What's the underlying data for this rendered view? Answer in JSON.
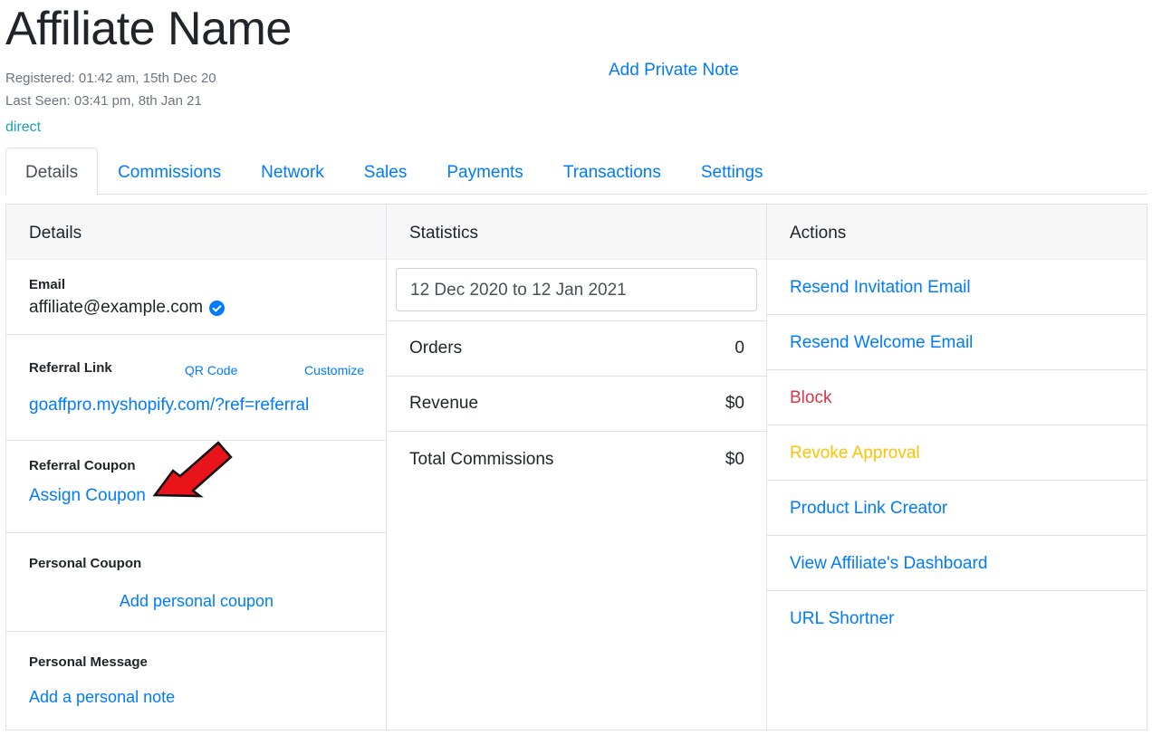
{
  "header": {
    "title": "Affiliate Name",
    "registered": "Registered: 01:42 am, 15th Dec 20",
    "last_seen": "Last Seen: 03:41 pm, 8th Jan 21",
    "source": "direct",
    "private_note_link": "Add Private Note"
  },
  "tabs": [
    {
      "label": "Details",
      "active": true
    },
    {
      "label": "Commissions"
    },
    {
      "label": "Network"
    },
    {
      "label": "Sales"
    },
    {
      "label": "Payments"
    },
    {
      "label": "Transactions"
    },
    {
      "label": "Settings"
    }
  ],
  "details": {
    "heading": "Details",
    "email_label": "Email",
    "email_value": "affiliate@example.com",
    "referral_link_label": "Referral Link",
    "qr_code_link": "QR Code",
    "customize_link": "Customize",
    "referral_link_value": "goaffpro.myshopify.com/?ref=referral",
    "referral_coupon_label": "Referral Coupon",
    "assign_coupon_link": "Assign Coupon",
    "personal_coupon_label": "Personal Coupon",
    "add_personal_coupon_link": "Add personal coupon",
    "personal_message_label": "Personal Message",
    "add_personal_note_link": "Add a personal note"
  },
  "statistics": {
    "heading": "Statistics",
    "date_range": "12 Dec 2020 to 12 Jan 2021",
    "rows": [
      {
        "label": "Orders",
        "value": "0"
      },
      {
        "label": "Revenue",
        "value": "$0"
      },
      {
        "label": "Total Commissions",
        "value": "$0"
      }
    ]
  },
  "actions": {
    "heading": "Actions",
    "items": [
      {
        "label": "Resend Invitation Email",
        "color": "#007bff"
      },
      {
        "label": "Resend Welcome Email",
        "color": "#007bff"
      },
      {
        "label": "Block",
        "color": "#dc3545"
      },
      {
        "label": "Revoke Approval",
        "color": "#ffc107"
      },
      {
        "label": "Product Link Creator",
        "color": "#007bff"
      },
      {
        "label": "View Affiliate's Dashboard",
        "color": "#007bff"
      },
      {
        "label": "URL Shortner",
        "color": "#007bff"
      }
    ]
  },
  "colors": {
    "link": "#007bff",
    "danger": "#dc3545",
    "warning": "#ffc107",
    "info": "#17a2b8",
    "verified_badge": "#007bff",
    "annotation_arrow": "#e8141a"
  },
  "icons": {
    "email_verified": "check-circle-icon",
    "annotation": "red-arrow-icon"
  }
}
